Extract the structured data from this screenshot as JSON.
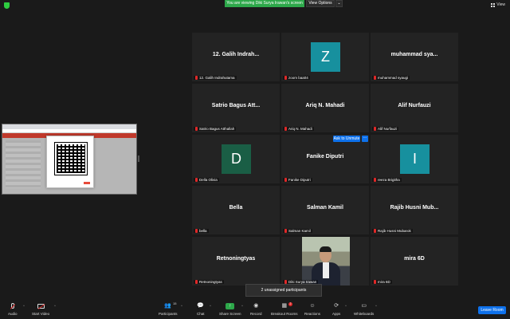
{
  "topbar": {
    "share_banner": "You are viewing Diki Surya Irawan's screen",
    "view_options": "View Options",
    "view_options_caret": "⌄",
    "view": "View"
  },
  "participants": [
    {
      "name": "12. Galih Indrah...",
      "label": "12. Galih Indrahutama",
      "kind": "name"
    },
    {
      "name": "",
      "label": "zoom baa04",
      "kind": "avatar",
      "initial": "Z",
      "color": "#17909e"
    },
    {
      "name": "muhammad sya...",
      "label": "muhammad syaugi",
      "kind": "name"
    },
    {
      "name": "Satrio Bagus Att...",
      "label": "Satrio Bagus Atthallah",
      "kind": "name"
    },
    {
      "name": "Ariq N. Mahadi",
      "label": "Ariq N. Mahadi",
      "kind": "name"
    },
    {
      "name": "Alif Nurfauzi",
      "label": "Alif Nurfauzi",
      "kind": "name"
    },
    {
      "name": "",
      "label": "Della Olivia",
      "kind": "avatar",
      "initial": "D",
      "color": "#1a5e45"
    },
    {
      "name": "Fanike Diputri",
      "label": "Fanike Diputri",
      "kind": "name"
    },
    {
      "name": "",
      "label": "reeza Brigitha",
      "kind": "avatar",
      "initial": "I",
      "color": "#17909e"
    },
    {
      "name": "Bella",
      "label": "bella",
      "kind": "name"
    },
    {
      "name": "Salman Kamil",
      "label": "Salman Kamil",
      "kind": "name"
    },
    {
      "name": "Rajib Husni Mub...",
      "label": "Rajib Husni Mubarok",
      "kind": "name"
    },
    {
      "name": "Retnoningtyas",
      "label": "Retnoningtyas",
      "kind": "name"
    },
    {
      "name": "",
      "label": "Diki Surya Irawan",
      "kind": "photo"
    },
    {
      "name": "mira 6D",
      "label": "mira 6D",
      "kind": "name"
    }
  ],
  "ask_to_unmute": "Ask to Unmute",
  "more": "···",
  "unassigned": "2 unassigned participants",
  "toolbar": {
    "audio": "Audio",
    "start_video": "Start Video",
    "participants": "Participants",
    "participants_count": "15",
    "chat": "Chat",
    "share_screen": "Share Screen",
    "record": "Record",
    "breakout_rooms": "Breakout Rooms",
    "breakout_badge": "2",
    "reactions": "Reactions",
    "apps": "Apps",
    "whiteboards": "Whiteboards",
    "leave": "Leave Room"
  },
  "colors": {
    "accent": "#0e71eb",
    "green": "#2da84a",
    "mute": "#e02828"
  }
}
